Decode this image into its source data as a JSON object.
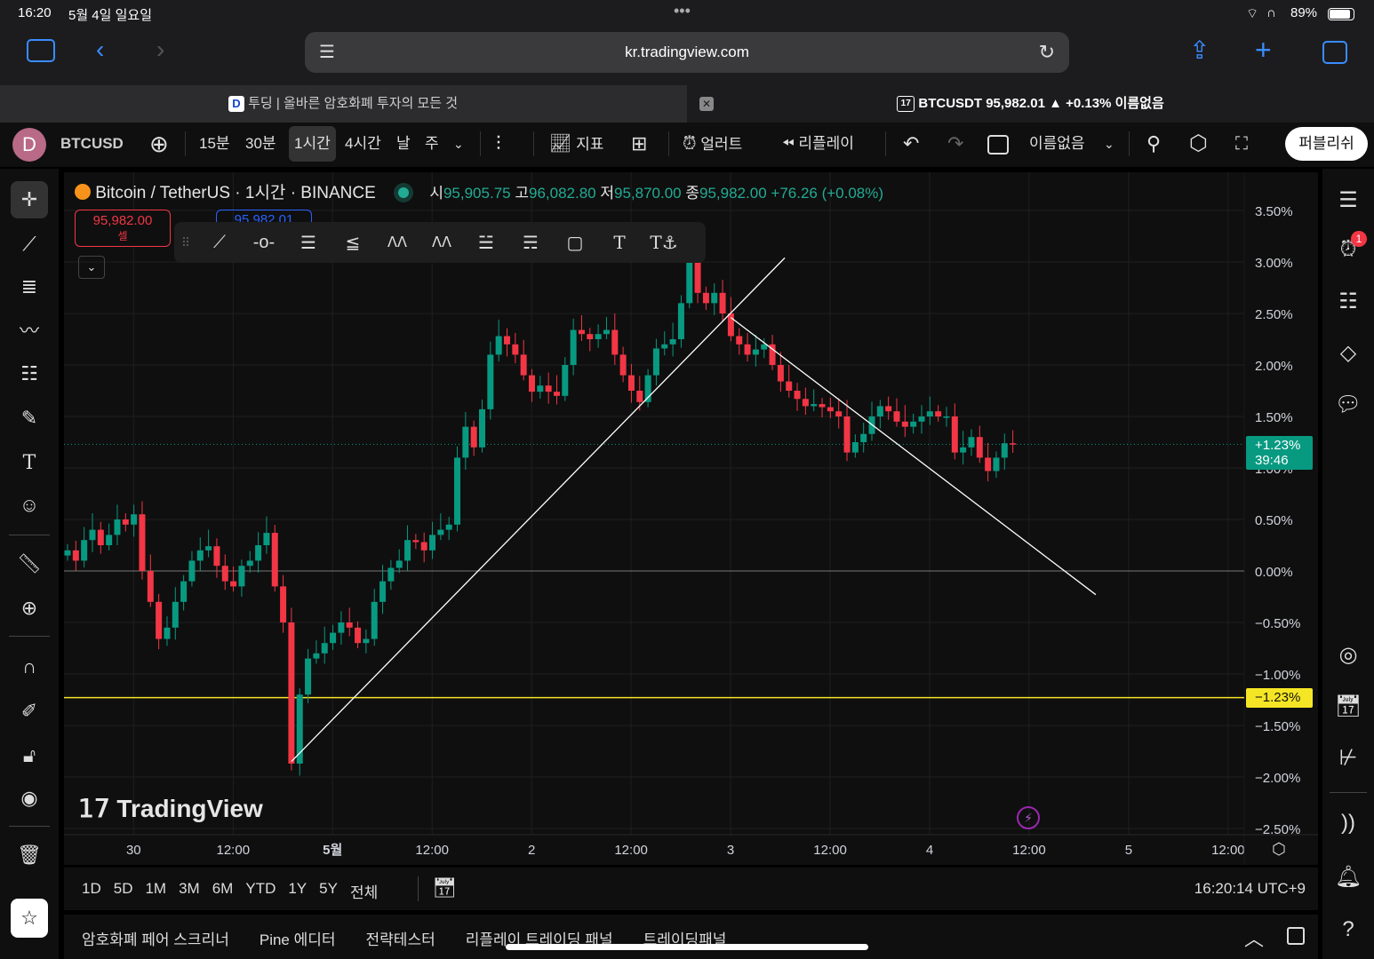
{
  "status": {
    "time": "16:20",
    "date": "5월 4일 일요일",
    "battery": "89%"
  },
  "browser": {
    "url": "kr.tradingview.com",
    "tabs": [
      {
        "label": "투딩 | 올바른 암호화폐 투자의 모든 것"
      },
      {
        "label": "BTCUSDT 95,982.01 ▲ +0.13% 이름없음"
      }
    ]
  },
  "toolbar": {
    "avatar": "D",
    "symbol": "BTCUSD",
    "intervals": [
      "15분",
      "30분",
      "1시간",
      "4시간",
      "날",
      "주"
    ],
    "active_interval": "1시간",
    "indicators": "지표",
    "alert": "얼러트",
    "replay": "리플레이",
    "layout_name": "이름없음",
    "publish": "퍼블리쉬"
  },
  "legend": {
    "title": "Bitcoin / TetherUS · 1시간 · BINANCE",
    "o_label": "시",
    "o": "95,905.75",
    "h_label": "고",
    "h": "96,082.80",
    "l_label": "저",
    "l": "95,870.00",
    "c_label": "종",
    "c": "95,982.00",
    "change": "+76.26 (+0.08%)"
  },
  "sell": {
    "price": "95,982.00",
    "label": "셀"
  },
  "buy": {
    "price": "95,982.01"
  },
  "price_badge": {
    "value": "+1.23%",
    "countdown": "39:46"
  },
  "yellow_badge": {
    "value": "−1.23%"
  },
  "watermark": "TradingView",
  "colors": {
    "up": "#089981",
    "down": "#f23645",
    "yellow": "#f5e625",
    "badge": "#089981"
  },
  "chart_data": {
    "type": "candlestick",
    "yunit": "percent",
    "ylim": [
      -2.55,
      3.75
    ],
    "y_ticks": [
      "3.50%",
      "3.00%",
      "2.50%",
      "2.00%",
      "1.50%",
      "1.00%",
      "0.50%",
      "0.00%",
      "−0.50%",
      "−1.00%",
      "−1.50%",
      "−2.00%",
      "−2.50%"
    ],
    "y_tick_values": [
      3.5,
      3.0,
      2.5,
      2.0,
      1.5,
      1.0,
      0.5,
      0.0,
      -0.5,
      -1.0,
      -1.5,
      -2.0,
      -2.5
    ],
    "x_ticks": [
      {
        "label": "30",
        "hour": 4
      },
      {
        "label": "12:00",
        "hour": 16
      },
      {
        "label": "5월",
        "hour": 28
      },
      {
        "label": "12:00",
        "hour": 40
      },
      {
        "label": "2",
        "hour": 52
      },
      {
        "label": "12:00",
        "hour": 64
      },
      {
        "label": "3",
        "hour": 76
      },
      {
        "label": "12:00",
        "hour": 88
      },
      {
        "label": "4",
        "hour": 100
      },
      {
        "label": "12:00",
        "hour": 112
      },
      {
        "label": "5",
        "hour": 124
      },
      {
        "label": "12:00",
        "hour": 136
      }
    ],
    "closes": [
      0.2,
      0.1,
      0.3,
      0.4,
      0.25,
      0.35,
      0.5,
      0.45,
      0.55,
      0.0,
      -0.3,
      -0.66,
      -0.55,
      -0.3,
      -0.1,
      0.1,
      0.2,
      0.24,
      0.05,
      -0.1,
      -0.15,
      0.05,
      0.1,
      0.25,
      0.37,
      -0.15,
      -0.5,
      -1.87,
      -1.2,
      -0.85,
      -0.8,
      -0.7,
      -0.6,
      -0.5,
      -0.55,
      -0.7,
      -0.66,
      -0.3,
      -0.1,
      0.03,
      0.1,
      0.3,
      0.28,
      0.2,
      0.35,
      0.4,
      0.45,
      1.1,
      1.4,
      1.2,
      1.57,
      2.1,
      2.28,
      2.2,
      2.1,
      1.9,
      1.74,
      1.8,
      1.74,
      1.7,
      2.0,
      2.34,
      2.3,
      2.25,
      2.3,
      2.34,
      2.1,
      1.9,
      1.75,
      1.64,
      1.9,
      2.16,
      2.2,
      2.25,
      2.6,
      3.05,
      2.7,
      2.6,
      2.7,
      2.5,
      2.28,
      2.2,
      2.1,
      2.15,
      2.2,
      2.0,
      1.84,
      1.75,
      1.67,
      1.6,
      1.62,
      1.59,
      1.55,
      1.5,
      1.15,
      1.25,
      1.33,
      1.5,
      1.6,
      1.55,
      1.45,
      1.4,
      1.45,
      1.5,
      1.55,
      1.5,
      1.5,
      1.15,
      1.2,
      1.3,
      1.1,
      0.97,
      1.1,
      1.24,
      1.23
    ],
    "current": 1.23,
    "horizontal_line": -1.23,
    "zero_line": 0,
    "trend_lines": [
      {
        "from": [
          27,
          -1.85
        ],
        "to": [
          86.5,
          3.04
        ]
      },
      {
        "from": [
          80,
          2.46
        ],
        "to": [
          124,
          -0.23
        ]
      }
    ]
  },
  "time_ranges": [
    "1D",
    "5D",
    "1M",
    "3M",
    "6M",
    "YTD",
    "1Y",
    "5Y",
    "전체"
  ],
  "clock": "16:20:14 UTC+9",
  "bottom_tabs": [
    "암호화폐 페어 스크리너",
    "Pine 에디터",
    "전략테스터",
    "리플레이 트레이딩 패널",
    "트레이딩패널"
  ],
  "alerts_badge": "1"
}
